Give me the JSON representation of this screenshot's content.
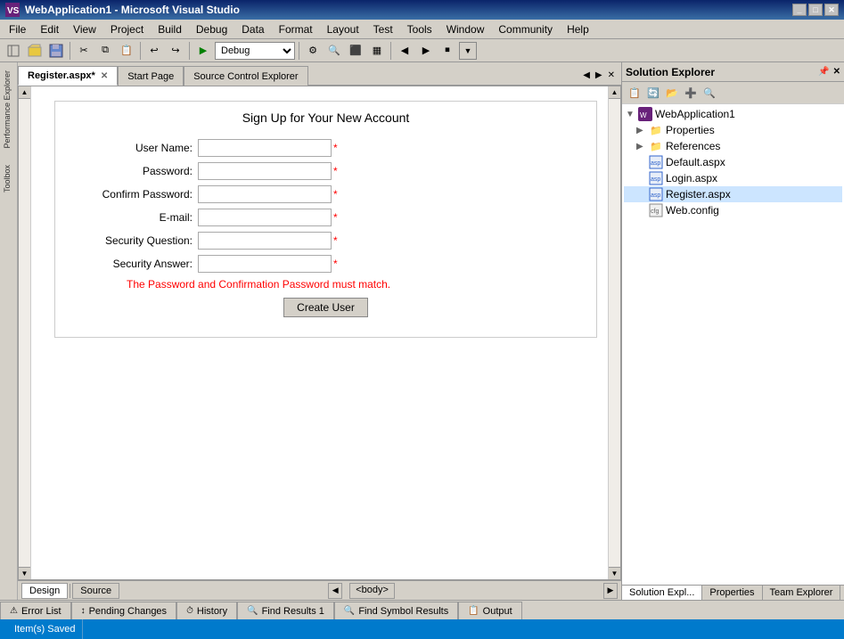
{
  "titleBar": {
    "title": "WebApplication1 - Microsoft Visual Studio",
    "icon": "VS"
  },
  "menuBar": {
    "items": [
      "File",
      "Edit",
      "View",
      "Project",
      "Build",
      "Debug",
      "Data",
      "Format",
      "Layout",
      "Test",
      "Tools",
      "Window",
      "Community",
      "Help"
    ]
  },
  "toolbar": {
    "debugMode": "Debug"
  },
  "tabs": {
    "active": "Register.aspx*",
    "items": [
      "Register.aspx*",
      "Start Page",
      "Source Control Explorer"
    ]
  },
  "form": {
    "title": "Sign Up for Your New Account",
    "fields": [
      {
        "label": "User Name:",
        "value": ""
      },
      {
        "label": "Password:",
        "value": ""
      },
      {
        "label": "Confirm Password:",
        "value": ""
      },
      {
        "label": "E-mail:",
        "value": ""
      },
      {
        "label": "Security Question:",
        "value": ""
      },
      {
        "label": "Security Answer:",
        "value": ""
      }
    ],
    "errorMessage": "The Password and Confirmation Password must match.",
    "createButton": "Create User"
  },
  "designSourceBar": {
    "design": "Design",
    "source": "Source",
    "body": "<body>"
  },
  "solutionExplorer": {
    "title": "Solution Explorer",
    "tree": {
      "root": "WebApplication1",
      "children": [
        {
          "name": "Properties",
          "type": "folder",
          "indent": 1
        },
        {
          "name": "References",
          "type": "folder",
          "indent": 1
        },
        {
          "name": "Default.aspx",
          "type": "webfile",
          "indent": 1
        },
        {
          "name": "Login.aspx",
          "type": "webfile",
          "indent": 1
        },
        {
          "name": "Register.aspx",
          "type": "webfile",
          "indent": 1
        },
        {
          "name": "Web.config",
          "type": "config",
          "indent": 1
        }
      ]
    },
    "bottomTabs": [
      "Solution Expl...",
      "Properties",
      "Team Explorer"
    ]
  },
  "bottomTabs": {
    "items": [
      {
        "label": "Error List",
        "icon": "⚠"
      },
      {
        "label": "Pending Changes",
        "icon": "↕"
      },
      {
        "label": "History",
        "icon": "⏱"
      },
      {
        "label": "Find Results 1",
        "icon": "🔍"
      },
      {
        "label": "Find Symbol Results",
        "icon": "🔍"
      },
      {
        "label": "Output",
        "icon": "📋"
      }
    ]
  },
  "statusBar": {
    "message": "Item(s) Saved"
  }
}
